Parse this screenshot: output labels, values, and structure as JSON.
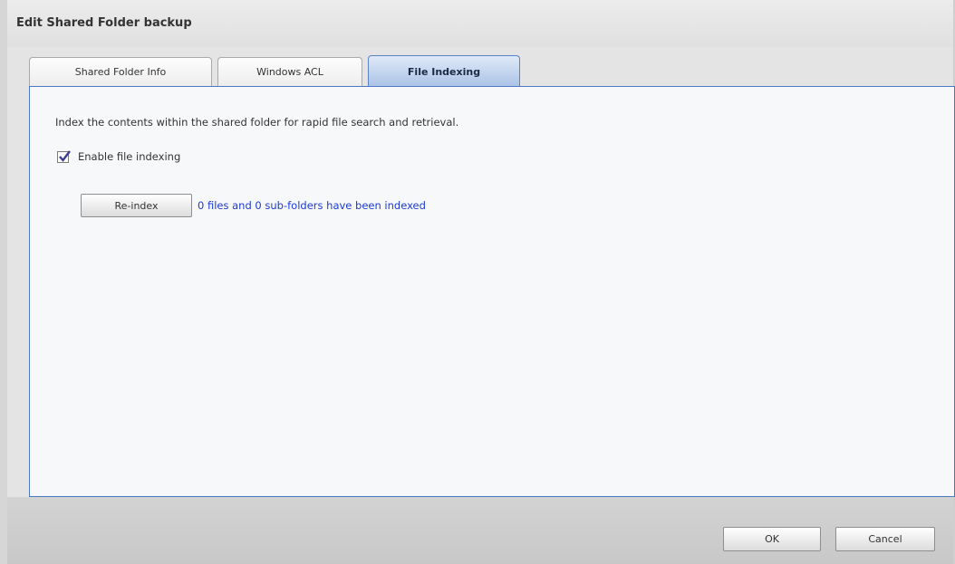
{
  "window": {
    "title": "Edit Shared Folder backup"
  },
  "tabs": [
    {
      "label": "Shared Folder Info"
    },
    {
      "label": "Windows ACL"
    },
    {
      "label": "File Indexing"
    }
  ],
  "file_indexing": {
    "description": "Index the contents within the shared folder for rapid file search and retrieval.",
    "enable_label": "Enable file indexing",
    "enable_checked": true,
    "reindex_label": "Re-index",
    "status": "0 files and 0 sub-folders have been indexed"
  },
  "footer": {
    "ok_label": "OK",
    "cancel_label": "Cancel"
  },
  "colors": {
    "accent": "#4d79c4",
    "status_text": "#1c3bd6"
  }
}
